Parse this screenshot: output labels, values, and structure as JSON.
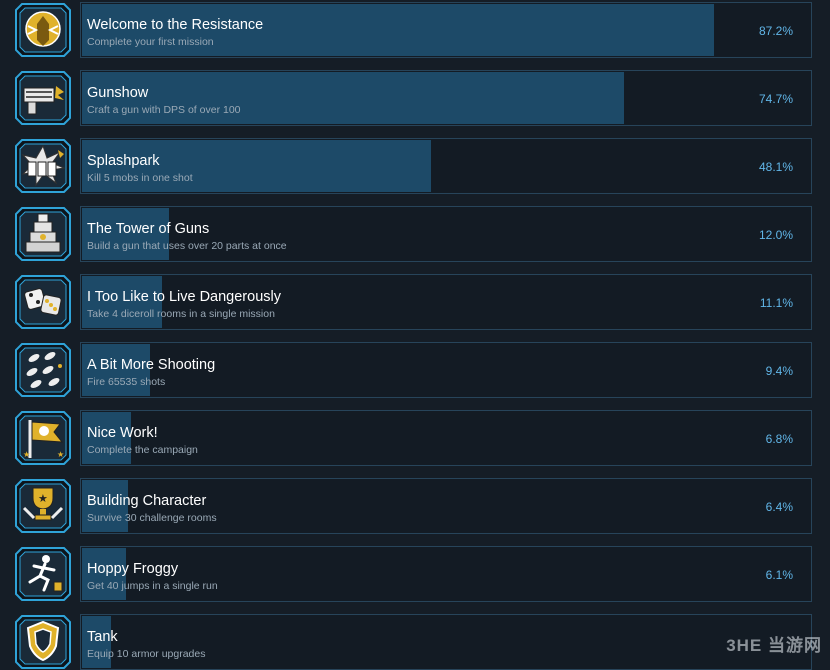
{
  "achievements": [
    {
      "title": "Welcome to the Resistance",
      "description": "Complete your first mission",
      "percent_label": "87.2%",
      "percent": 87.2,
      "icon": "winged-emblem-icon"
    },
    {
      "title": "Gunshow",
      "description": "Craft a gun with DPS of over 100",
      "percent_label": "74.7%",
      "percent": 74.7,
      "icon": "gun-icon"
    },
    {
      "title": "Splashpark",
      "description": "Kill 5 mobs in one shot",
      "percent_label": "48.1%",
      "percent": 48.1,
      "icon": "explosion-icon"
    },
    {
      "title": "The Tower of Guns",
      "description": "Build a gun that uses over 20 parts at once",
      "percent_label": "12.0%",
      "percent": 12.0,
      "icon": "gun-tower-icon"
    },
    {
      "title": "I Too Like to Live Dangerously",
      "description": "Take 4 diceroll rooms in a single mission",
      "percent_label": "11.1%",
      "percent": 11.1,
      "icon": "dice-icon"
    },
    {
      "title": "A Bit More Shooting",
      "description": "Fire 65535 shots",
      "percent_label": "9.4%",
      "percent": 9.4,
      "icon": "bullets-icon"
    },
    {
      "title": "Nice Work!",
      "description": "Complete the campaign",
      "percent_label": "6.8%",
      "percent": 6.8,
      "icon": "flag-icon"
    },
    {
      "title": "Building Character",
      "description": "Survive 30 challenge rooms",
      "percent_label": "6.4%",
      "percent": 6.4,
      "icon": "trophy-icon"
    },
    {
      "title": "Hoppy Froggy",
      "description": "Get 40 jumps in a single run",
      "percent_label": "6.1%",
      "percent": 6.1,
      "icon": "jumping-figure-icon"
    },
    {
      "title": "Tank",
      "description": "Equip 10 armor upgrades",
      "percent_label": "",
      "percent": 4.0,
      "icon": "armor-shield-icon"
    }
  ],
  "watermark": "3HE 当游网",
  "colors": {
    "background": "#151d26",
    "bar": "#1d4a68",
    "card_border": "#27445a",
    "percent_text": "#61b6e8",
    "badge_frame": "#2fa3d8",
    "badge_gold": "#e0b22b"
  }
}
